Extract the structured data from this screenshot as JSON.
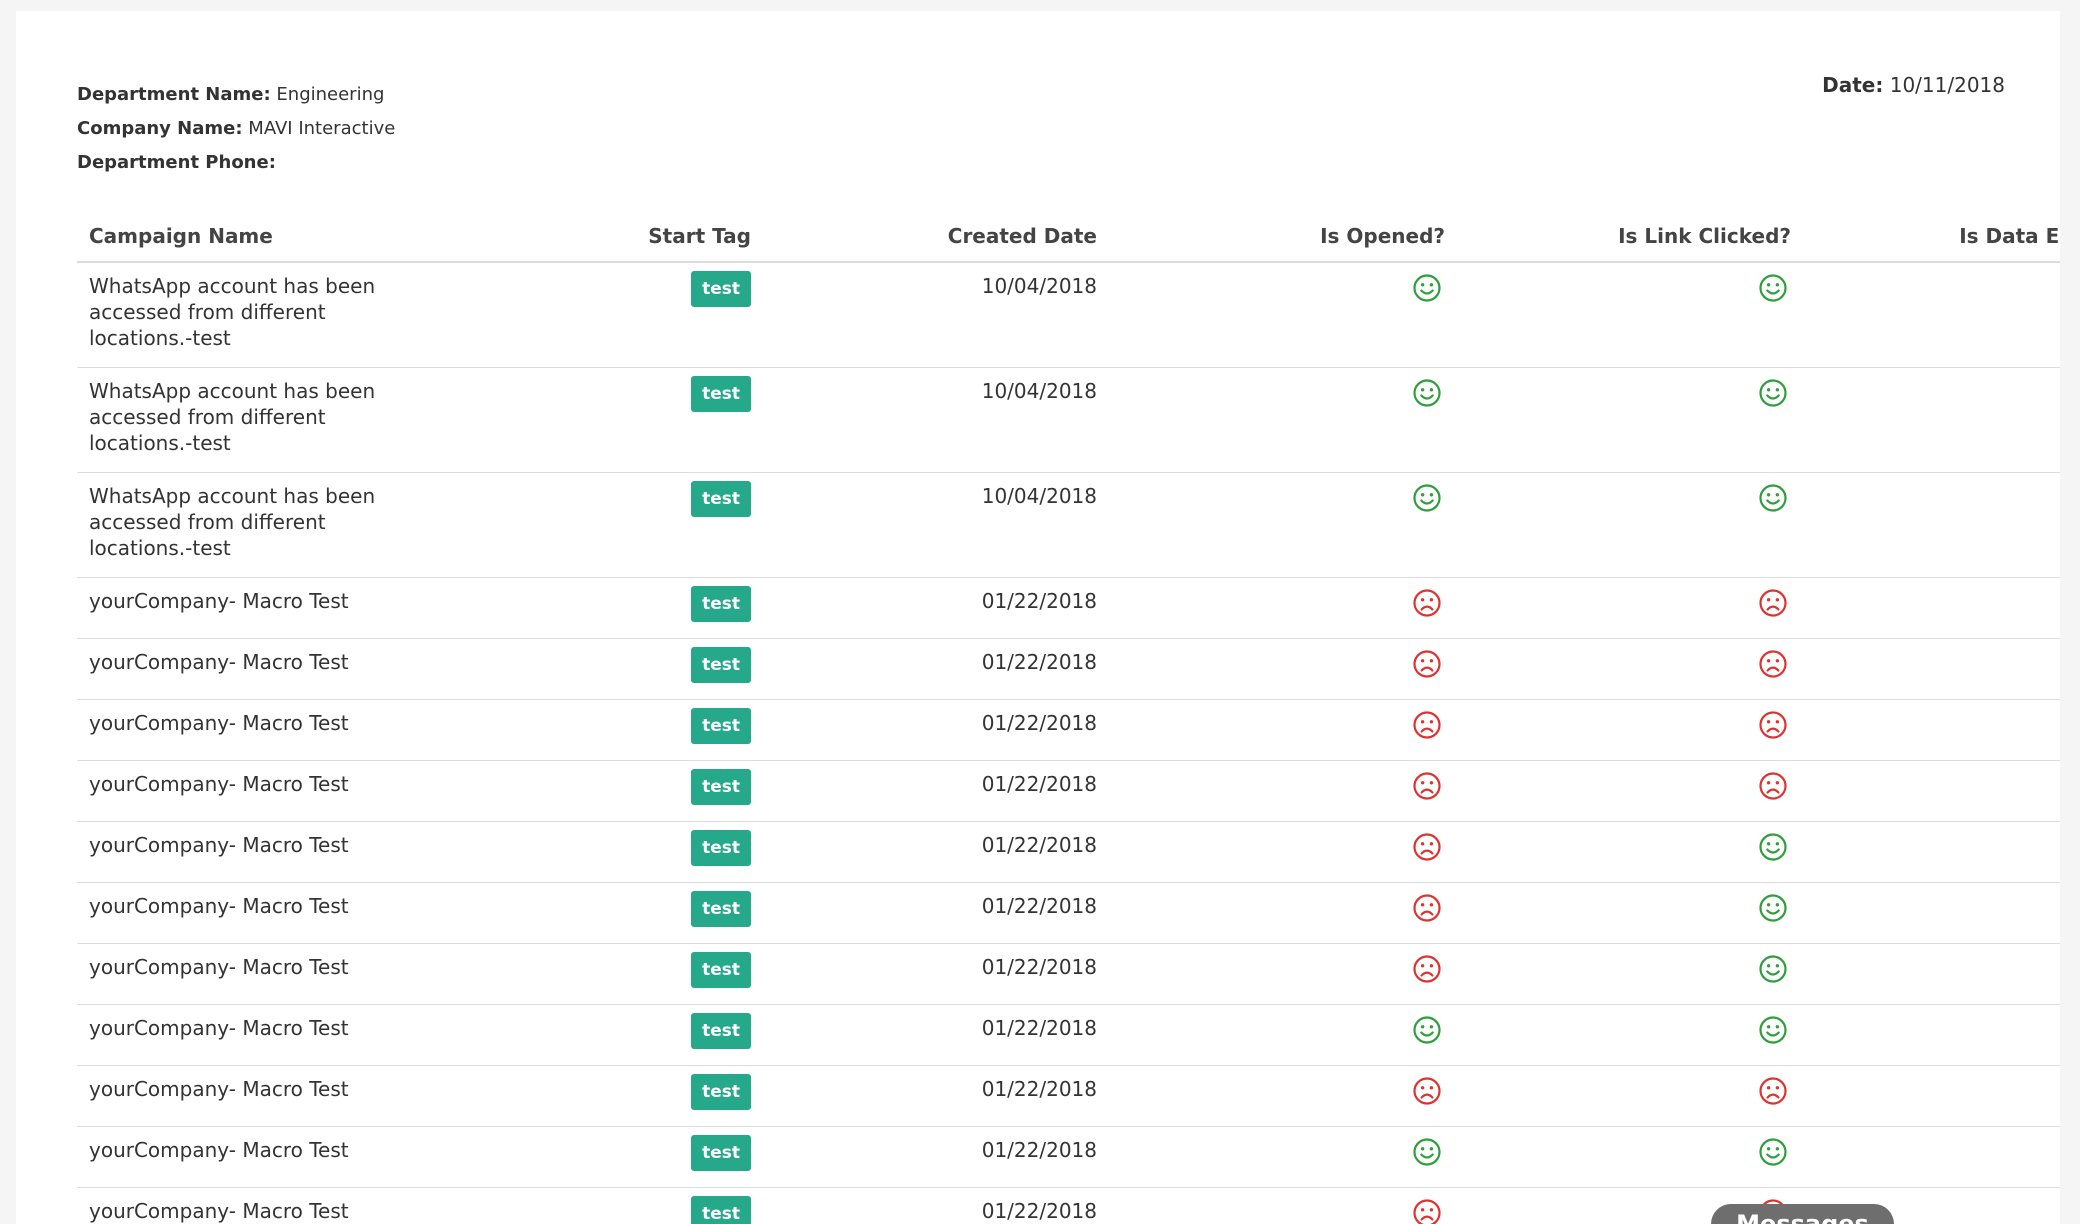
{
  "header": {
    "department_name_label": "Department Name:",
    "department_name_value": "Engineering",
    "company_name_label": "Company Name:",
    "company_name_value": "MAVI Interactive",
    "department_phone_label": "Department Phone:",
    "department_phone_value": "",
    "date_label": "Date:",
    "date_value": "10/11/2018"
  },
  "table": {
    "columns": [
      "Campaign Name",
      "Start Tag",
      "Created Date",
      "Is Opened?",
      "Is Link Clicked?",
      "Is Data Entered?"
    ],
    "rows": [
      {
        "name": "WhatsApp account has been accessed from different locations.-test",
        "tag": "test",
        "date": "10/04/2018",
        "opened": true,
        "link_clicked": true,
        "data_entered": true
      },
      {
        "name": "WhatsApp account has been accessed from different locations.-test",
        "tag": "test",
        "date": "10/04/2018",
        "opened": true,
        "link_clicked": true,
        "data_entered": true
      },
      {
        "name": "WhatsApp account has been accessed from different locations.-test",
        "tag": "test",
        "date": "10/04/2018",
        "opened": true,
        "link_clicked": true,
        "data_entered": true
      },
      {
        "name": "yourCompany- Macro Test",
        "tag": "test",
        "date": "01/22/2018",
        "opened": false,
        "link_clicked": false,
        "data_entered": true
      },
      {
        "name": "yourCompany- Macro Test",
        "tag": "test",
        "date": "01/22/2018",
        "opened": false,
        "link_clicked": false,
        "data_entered": true
      },
      {
        "name": "yourCompany- Macro Test",
        "tag": "test",
        "date": "01/22/2018",
        "opened": false,
        "link_clicked": false,
        "data_entered": true
      },
      {
        "name": "yourCompany- Macro Test",
        "tag": "test",
        "date": "01/22/2018",
        "opened": false,
        "link_clicked": false,
        "data_entered": true
      },
      {
        "name": "yourCompany- Macro Test",
        "tag": "test",
        "date": "01/22/2018",
        "opened": false,
        "link_clicked": true,
        "data_entered": true
      },
      {
        "name": "yourCompany- Macro Test",
        "tag": "test",
        "date": "01/22/2018",
        "opened": false,
        "link_clicked": true,
        "data_entered": true
      },
      {
        "name": "yourCompany- Macro Test",
        "tag": "test",
        "date": "01/22/2018",
        "opened": false,
        "link_clicked": true,
        "data_entered": true
      },
      {
        "name": "yourCompany- Macro Test",
        "tag": "test",
        "date": "01/22/2018",
        "opened": true,
        "link_clicked": true,
        "data_entered": true
      },
      {
        "name": "yourCompany- Macro Test",
        "tag": "test",
        "date": "01/22/2018",
        "opened": false,
        "link_clicked": false,
        "data_entered": true
      },
      {
        "name": "yourCompany- Macro Test",
        "tag": "test",
        "date": "01/22/2018",
        "opened": true,
        "link_clicked": true,
        "data_entered": true
      },
      {
        "name": "yourCompany- Macro Test",
        "tag": "test",
        "date": "01/22/2018",
        "opened": false,
        "link_clicked": false,
        "data_entered": true
      }
    ]
  },
  "icons": {
    "yes": "smile-icon",
    "no": "frown-icon"
  },
  "colors": {
    "tag_bg": "#26a98b",
    "smile": "#2e9e3c",
    "frown": "#e03131"
  },
  "messages_button": {
    "label": "Messages"
  }
}
